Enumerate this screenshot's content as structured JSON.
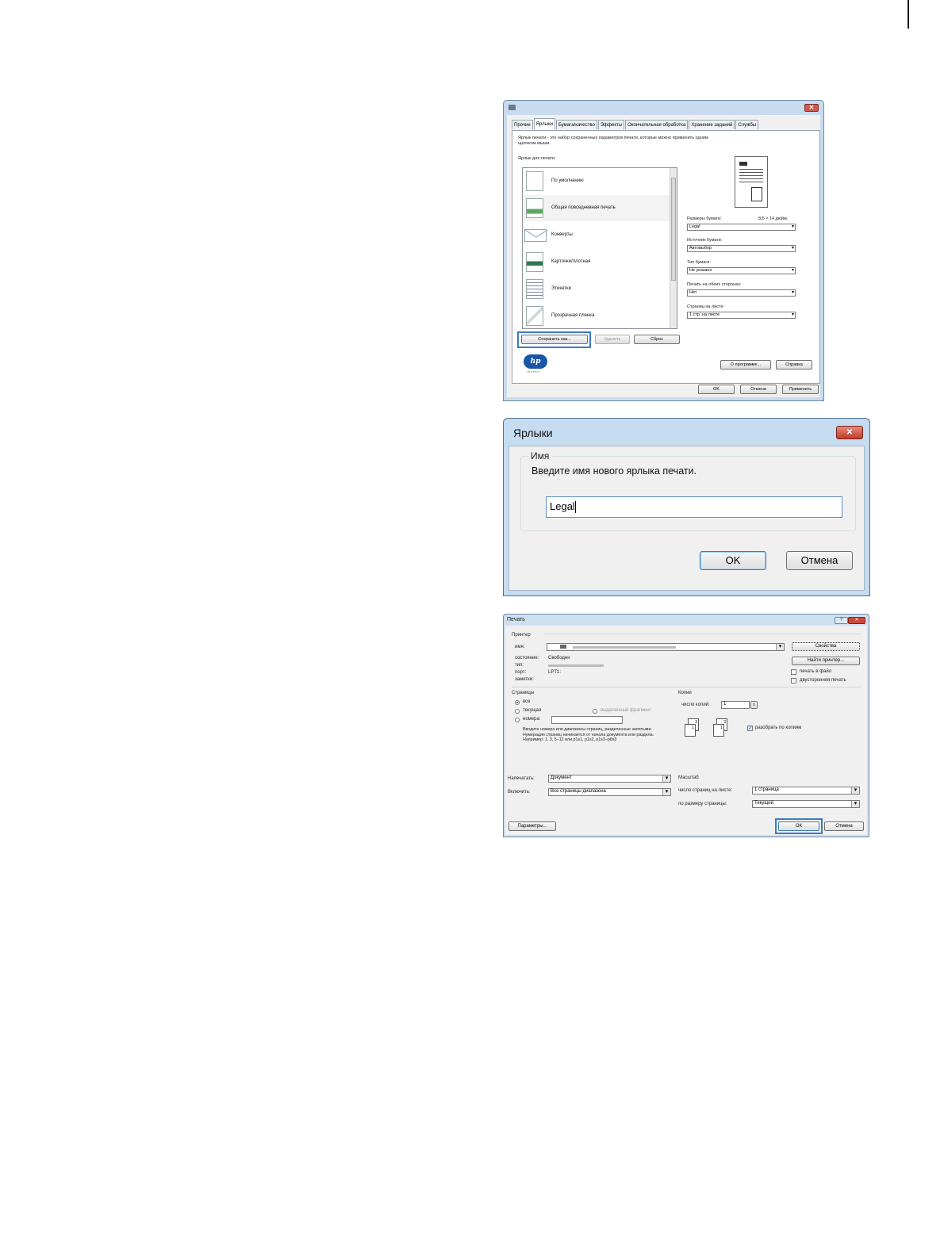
{
  "window1": {
    "tabs": [
      "Прочие",
      "Ярлыки",
      "Бумага/качество",
      "Эффекты",
      "Окончательная обработка",
      "Хранение заданий",
      "Службы"
    ],
    "description": "Ярлык печати - это набор сохраненных параметров печати, которые можно применить одним щелчком мыши.",
    "list_label": "Ярлык для печати:",
    "shortcuts": [
      "По умолчанию",
      "Общая повседневная печать",
      "Конверты",
      "Карточки/плотная",
      "Этикетки",
      "Прозрачная пленка"
    ],
    "paper_size_label": "Размеры бумаги:",
    "paper_size_dims": "8,5 × 14 дюйм.",
    "paper_size_value": "Legal",
    "paper_source_label": "Источник бумаги:",
    "paper_source_value": "Автовыбор",
    "paper_type_label": "Тип бумаги:",
    "paper_type_value": "Не указано",
    "duplex_label": "Печать на обеих сторонах:",
    "duplex_value": "Нет",
    "pages_per_sheet_label": "Страниц на листе:",
    "pages_per_sheet_value": "1 стр. на листе",
    "save_as": "Сохранить как...",
    "delete": "Удалить",
    "reset": "Сброс",
    "about": "О программе...",
    "help": "Справка",
    "ok": "OK",
    "cancel": "Отмена",
    "apply": "Применить",
    "logo": "hp",
    "logo_tagline": "invent"
  },
  "window2": {
    "title": "Ярлыки",
    "group_label": "Имя",
    "prompt": "Введите имя нового ярлыка печати.",
    "input_value": "Legal",
    "ok": "OK",
    "cancel": "Отмена"
  },
  "window3": {
    "title": "Печать",
    "printer_group": "Принтер",
    "name_label": "имя:",
    "status_label": "состояние:",
    "status_value": "Свободен",
    "type_label": "тип:",
    "port_label": "порт:",
    "port_value": "LPT1:",
    "notes_label": "заметки:",
    "properties": "Свойства",
    "find_printer": "Найти принтер...",
    "print_to_file": "печать в файл",
    "duplex_print": "двусторонняя печать",
    "pages_group": "Страницы",
    "all": "все",
    "current": "текущая",
    "selection": "выделенный фрагмент",
    "pages": "номера:",
    "pages_hint": "Вводите номера или диапазоны страниц, разделенные запятыми. Нумерация страниц начинается от начала документа или раздела. Например: 1, 3, 5–12 или p1s1, p1s2, p1s3–p8s3",
    "copies_group": "Копии",
    "copies_label": "число копий:",
    "copies_value": "1",
    "collate": "разобрать по копиям",
    "print_what_label": "Напечатать:",
    "print_what_value": "Документ",
    "include_label": "Включить:",
    "include_value": "Все страницы диапазона",
    "scale_group": "Масштаб",
    "pages_per_sheet_label": "число страниц на листе:",
    "pages_per_sheet_value": "1 страница",
    "scale_to_label": "по размеру страницы:",
    "scale_to_value": "Текущий",
    "options": "Параметры...",
    "ok": "ОК",
    "cancel": "Отмена"
  }
}
